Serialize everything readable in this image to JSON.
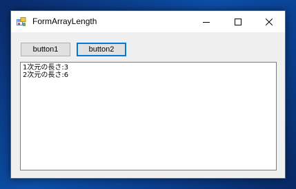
{
  "window": {
    "title": "FormArrayLength",
    "icon": "winforms-app-icon",
    "controls": {
      "minimize_icon": "minimize-icon",
      "maximize_icon": "maximize-icon",
      "close_icon": "close-icon"
    }
  },
  "buttons": {
    "button1_label": "button1",
    "button2_label": "button2"
  },
  "textbox": {
    "lines": [
      "1次元の長さ:3",
      "2次元の長さ:6"
    ]
  },
  "colors": {
    "accent": "#0078d7",
    "window_border": "#1e73c8",
    "form_background": "#f0f0f0"
  }
}
